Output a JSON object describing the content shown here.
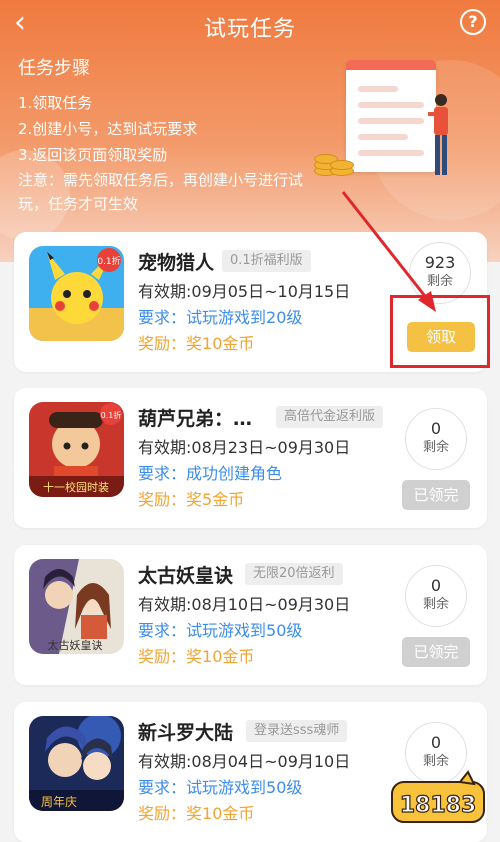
{
  "header": {
    "title": "试玩任务",
    "back_icon": "‹",
    "help_icon": "?"
  },
  "steps": {
    "heading": "任务步骤",
    "lines": [
      "1.领取任务",
      "2.创建小号，达到试玩要求",
      "3.返回该页面领取奖励"
    ],
    "note": "注意：需先领取任务后，再创建小号进行试玩，任务才可生效"
  },
  "tasks": [
    {
      "name": "宠物猎人",
      "tag": "0.1折福利版",
      "validity": "有效期:09月05日~10月15日",
      "req_label": "要求：",
      "req": "试玩游戏到20级",
      "reward_label": "奖励：",
      "reward": "奖10金币",
      "remain": "923",
      "remain_label": "剩余",
      "button": "领取",
      "badge": "0.1折"
    },
    {
      "name": "葫芦兄弟：…",
      "tag": "高倍代金返利版",
      "validity": "有效期:08月23日~09月30日",
      "req_label": "要求：",
      "req": "成功创建角色",
      "reward_label": "奖励：",
      "reward": "奖5金币",
      "remain": "0",
      "remain_label": "剩余",
      "button": "已领完",
      "badge": "0.1折",
      "icon_caption": "十一校园时装"
    },
    {
      "name": "太古妖皇诀",
      "tag": "无限20倍返利",
      "validity": "有效期:08月10日~09月30日",
      "req_label": "要求：",
      "req": "试玩游戏到50级",
      "reward_label": "奖励：",
      "reward": "奖10金币",
      "remain": "0",
      "remain_label": "剩余",
      "button": "已领完",
      "icon_caption": "太古妖皇诀"
    },
    {
      "name": "新斗罗大陆",
      "tag": "登录送sss魂师",
      "validity": "有效期:08月04日~09月10日",
      "req_label": "要求：",
      "req": "试玩游戏到50级",
      "reward_label": "奖励：",
      "reward": "奖10金币",
      "remain": "0",
      "remain_label": "剩余",
      "icon_caption": "周年庆"
    }
  ],
  "watermark": "18183",
  "colors": {
    "accent_orange": "#f07a3f",
    "requirement_blue": "#3b8dee",
    "reward_gold": "#f0a432",
    "claim_button": "#f5c143",
    "highlight_red": "#e0282c"
  }
}
